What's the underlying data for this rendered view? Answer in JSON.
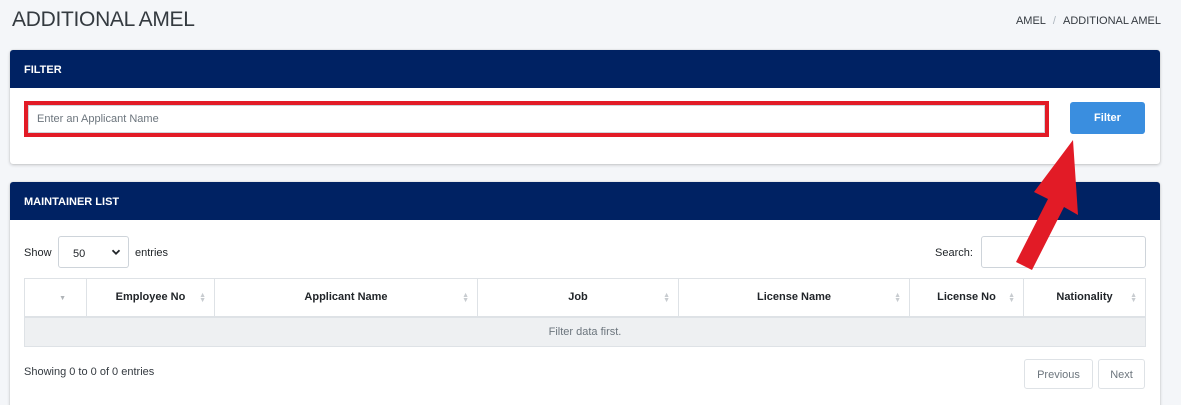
{
  "page": {
    "title": "ADDITIONAL AMEL",
    "breadcrumb": [
      "AMEL",
      "ADDITIONAL AMEL"
    ]
  },
  "filter_card": {
    "header": "FILTER",
    "input_placeholder": "Enter an Applicant Name",
    "input_value": "",
    "button_label": "Filter"
  },
  "list_card": {
    "header": "MAINTAINER LIST",
    "show_label": "Show",
    "page_length": "50",
    "entries_label": "entries",
    "search_label": "Search:",
    "search_value": "",
    "columns": [
      "",
      "Employee No",
      "Applicant Name",
      "Job",
      "License Name",
      "License No",
      "Nationality"
    ],
    "empty_message": "Filter data first.",
    "info": "Showing 0 to 0 of 0 entries",
    "previous_label": "Previous",
    "next_label": "Next"
  },
  "colors": {
    "header_bg": "#002263",
    "button_bg": "#3a8edf",
    "annotation_red": "#e21b26"
  },
  "icons": [
    "chevron-down-icon",
    "sort-icon",
    "red-arrow-annotation"
  ]
}
